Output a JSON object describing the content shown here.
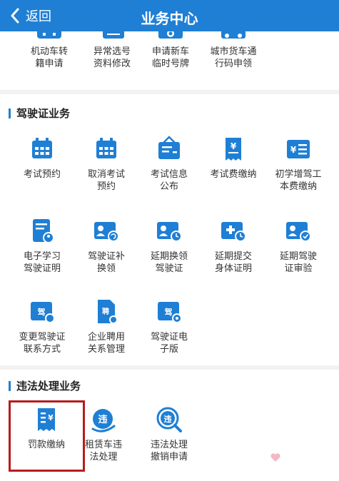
{
  "header": {
    "back_label": "返回",
    "title": "业务中心"
  },
  "top_row": [
    {
      "line1": "机动车转",
      "line2": "籍申请",
      "icon": "car-transfer-icon"
    },
    {
      "line1": "异常选号",
      "line2": "资料修改",
      "icon": "edit-doc-icon"
    },
    {
      "line1": "申请新车",
      "line2": "临时号牌",
      "icon": "license-plate-icon"
    },
    {
      "line1": "城市货车通",
      "line2": "行码申领",
      "icon": "truck-icon"
    }
  ],
  "sections": {
    "license": {
      "title": "驾驶证业务",
      "items": [
        {
          "line1": "考试预约",
          "line2": "",
          "icon": "calendar-icon"
        },
        {
          "line1": "取消考试",
          "line2": "预约",
          "icon": "calendar-cancel-icon"
        },
        {
          "line1": "考试信息",
          "line2": "公布",
          "icon": "announcement-icon"
        },
        {
          "line1": "考试费缴纳",
          "line2": "",
          "icon": "fee-receipt-icon"
        },
        {
          "line1": "初学增驾工",
          "line2": "本费缴纳",
          "icon": "yuan-list-icon"
        },
        {
          "line1": "电子学习",
          "line2": "驾驶证明",
          "icon": "document-user-icon"
        },
        {
          "line1": "驾驶证补",
          "line2": "换领",
          "icon": "id-card-refresh-icon"
        },
        {
          "line1": "延期换领",
          "line2": "驾驶证",
          "icon": "id-card-clock-icon"
        },
        {
          "line1": "延期提交",
          "line2": "身体证明",
          "icon": "medical-clock-icon"
        },
        {
          "line1": "延期驾驶",
          "line2": "证审验",
          "icon": "id-card-check-icon"
        },
        {
          "line1": "变更驾驶证",
          "line2": "联系方式",
          "icon": "license-phone-icon"
        },
        {
          "line1": "企业聘用",
          "line2": "关系管理",
          "icon": "employment-doc-icon"
        },
        {
          "line1": "驾驶证电",
          "line2": "子版",
          "icon": "e-license-icon"
        }
      ]
    },
    "violation": {
      "title": "违法处理业务",
      "items": [
        {
          "line1": "罚款缴纳",
          "line2": "",
          "icon": "fine-receipt-icon"
        },
        {
          "line1": "租赁车违",
          "line2": "法处理",
          "icon": "rental-violation-icon"
        },
        {
          "line1": "违法处理",
          "line2": "撤销申请",
          "icon": "violation-search-icon"
        }
      ]
    }
  },
  "colors": {
    "primary": "#1f7fd4",
    "highlight": "#b81c1c"
  }
}
